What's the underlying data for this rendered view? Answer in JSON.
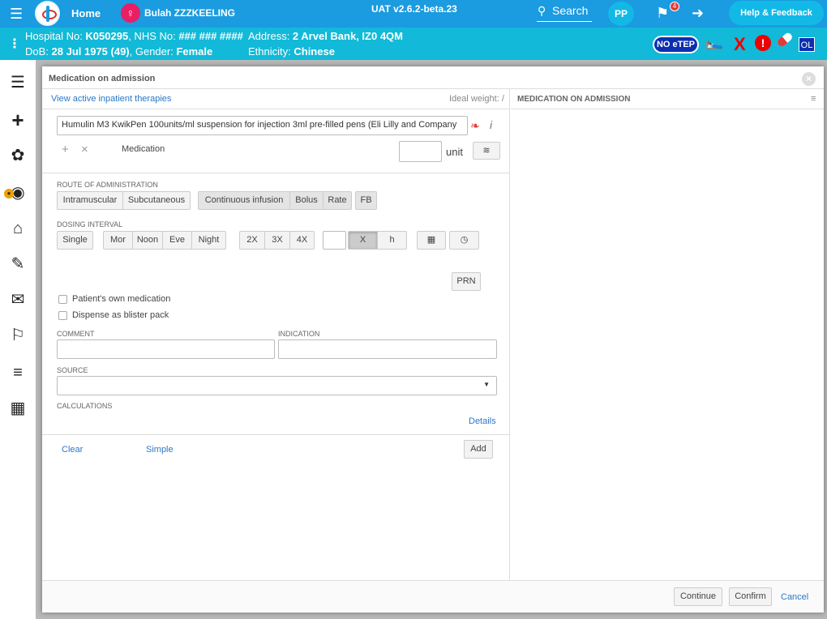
{
  "topbar": {
    "home": "Home",
    "patient_name": "Bulah ZZZKEELING",
    "version": "UAT v2.6.2-beta.23",
    "search": "Search",
    "user_initials": "PP",
    "flag_count": "4",
    "help": "Help & Feedback"
  },
  "patient": {
    "hospital_label": "Hospital No: ",
    "hospital_no": "K050295",
    "nhs_label": ", NHS No: ",
    "nhs_no": "### ### ####",
    "dob_label": "DoB: ",
    "dob": "28 Jul 1975 (49)",
    "gender_label": ", Gender: ",
    "gender": "Female",
    "address_label": "Address: ",
    "address": "2 Arvel Bank, IZ0 4QM",
    "ethnicity_label": "Ethnicity: ",
    "ethnicity": "Chinese",
    "noetep": "NO eTEP",
    "ol": "OL"
  },
  "dialog": {
    "title": "Medication on admission",
    "view_active": "View active inpatient therapies",
    "ideal_weight": "Ideal weight: /",
    "right_header": "MEDICATION ON ADMISSION",
    "medication_value": "Humulin M3 KwikPen 100units/ml suspension for injection 3ml pre-filled pens (Eli Lilly and Company",
    "medication_label": "Medication",
    "unit": "unit",
    "route_label": "ROUTE OF ADMINISTRATION",
    "route_options": [
      "Intramuscular",
      "Subcutaneous"
    ],
    "infusion_options": [
      "Continuous infusion",
      "Bolus",
      "Rate"
    ],
    "fb": "FB",
    "dosing_label": "DOSING INTERVAL",
    "single": "Single",
    "times": [
      "Mor",
      "Noon",
      "Eve",
      "Night"
    ],
    "freq": [
      "2X",
      "3X",
      "4X"
    ],
    "x": "X",
    "h": "h",
    "prn": "PRN",
    "own_med": "Patient's own medication",
    "blister": "Dispense as blister pack",
    "comment_label": "COMMENT",
    "indication_label": "INDICATION",
    "source_label": "SOURCE",
    "calculations_label": "CALCULATIONS",
    "details": "Details",
    "clear": "Clear",
    "simple": "Simple",
    "add": "Add",
    "continue": "Continue",
    "confirm": "Confirm",
    "cancel": "Cancel"
  }
}
